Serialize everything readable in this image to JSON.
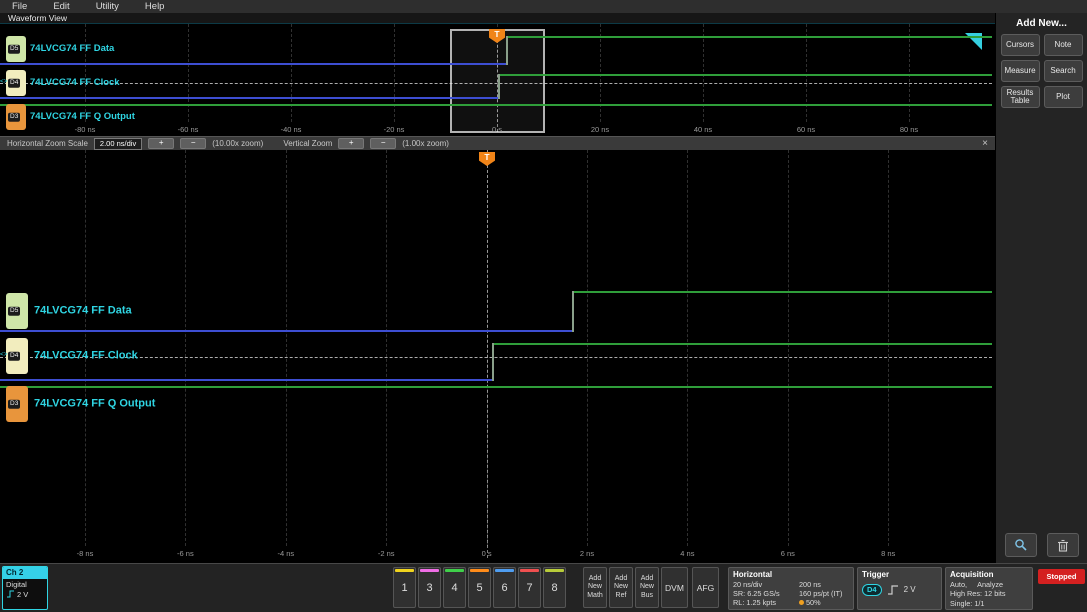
{
  "colors": {
    "cyan": "#2fd5e3",
    "blue_low": "#3d4ed2",
    "green_high": "#2f9e3a",
    "edge": "#8aa08a",
    "orange": "#f08418",
    "red": "#d42020"
  },
  "menu": {
    "items": [
      "File",
      "Edit",
      "Utility",
      "Help"
    ]
  },
  "view_tab": "Waveform View",
  "channels": [
    {
      "bit": "D5",
      "label": "74LVCG74 FF Data",
      "tab_color": "#cfe6a8"
    },
    {
      "bit": "D4",
      "label": "74LVCG74 FF Clock",
      "tab_color": "#f2edbe"
    },
    {
      "bit": "D3",
      "label": "74LVCG74 FF Q Output",
      "tab_color": "#e8953c"
    }
  ],
  "waveforms": {
    "data": {
      "before": "low",
      "after": "high",
      "transition_ns": 1.7
    },
    "clock": {
      "before": "low",
      "after": "high",
      "transition_ns": 0.1
    },
    "q_output": {
      "state": "high"
    }
  },
  "overview_axis": [
    "-80 ns",
    "-60 ns",
    "-40 ns",
    "-20 ns",
    "0 s",
    "20 ns",
    "40 ns",
    "60 ns",
    "80 ns"
  ],
  "zoom_axis": [
    "-8 ns",
    "-6 ns",
    "-4 ns",
    "-2 ns",
    "0 s",
    "2 ns",
    "4 ns",
    "6 ns",
    "8 ns"
  ],
  "trigger_marker": "T",
  "trigger_source_marker": "<>",
  "zoom_toolbar": {
    "h_label": "Horizontal Zoom Scale",
    "h_value": "2.00 ns/div",
    "plus": "+",
    "minus": "−",
    "h_zoom": "(10.00x zoom)",
    "v_label": "Vertical Zoom",
    "v_zoom": "(1.00x zoom)",
    "close": "×"
  },
  "sidebar": {
    "title": "Add New...",
    "buttons": [
      "Cursors",
      "Note",
      "Measure",
      "Search",
      "Results Table",
      "Plot"
    ],
    "icon_buttons": [
      "magnifier-icon",
      "trash-icon"
    ]
  },
  "bottom": {
    "ch2": {
      "name": "Ch 2",
      "mode": "Digital",
      "threshold": "2 V"
    },
    "channel_buttons": [
      {
        "n": "1",
        "color": "#f0d41e"
      },
      {
        "n": "3",
        "color": "#f06ee6"
      },
      {
        "n": "4",
        "color": "#3fd04a"
      },
      {
        "n": "5",
        "color": "#ff8c1a"
      },
      {
        "n": "6",
        "color": "#4f9df0"
      },
      {
        "n": "7",
        "color": "#f05050"
      },
      {
        "n": "8",
        "color": "#b8cc3a"
      }
    ],
    "add_buttons": [
      {
        "lines": [
          "Add",
          "New",
          "Math"
        ]
      },
      {
        "lines": [
          "Add",
          "New",
          "Ref"
        ]
      },
      {
        "lines": [
          "Add",
          "New",
          "Bus"
        ]
      }
    ],
    "dvm": "DVM",
    "afg": "AFG",
    "horizontal": {
      "title": "Horizontal",
      "cells": [
        [
          "20 ns/div",
          "200 ns"
        ],
        [
          "SR: 6.25 GS/s",
          "160 ps/pt (IT)"
        ],
        [
          "RL: 1.25 kpts",
          "50%"
        ]
      ]
    },
    "trigger": {
      "title": "Trigger",
      "source": "D4",
      "level": "2 V"
    },
    "acquisition": {
      "title": "Acquisition",
      "line1a": "Auto,",
      "line1b": "Analyze",
      "line2": "High Res: 12 bits",
      "line3": "Single: 1/1"
    },
    "stopped": "Stopped"
  }
}
